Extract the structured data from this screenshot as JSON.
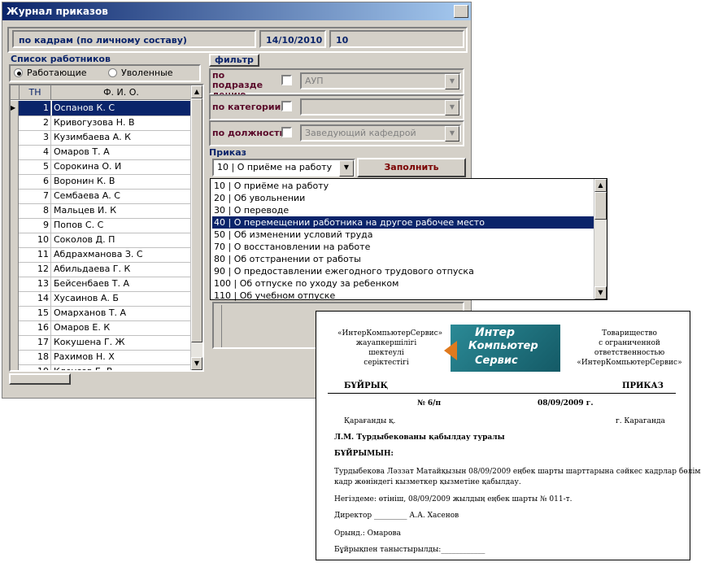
{
  "window": {
    "title": "Журнал приказов"
  },
  "header": {
    "department": "по кадрам (по личному составу)",
    "date": "14/10/2010",
    "number": "10"
  },
  "employees": {
    "title": "Список работников",
    "radio_working": "Работающие",
    "radio_fired": "Уволенные",
    "col_tn": "ТН",
    "col_fio": "Ф. И. О.",
    "rows": [
      {
        "tn": "1",
        "fio": "Оспанов К. С"
      },
      {
        "tn": "2",
        "fio": "Кривогузова Н. В"
      },
      {
        "tn": "3",
        "fio": "Кузимбаева А. К"
      },
      {
        "tn": "4",
        "fio": "Омаров Т. А"
      },
      {
        "tn": "5",
        "fio": "Сорокина О. И"
      },
      {
        "tn": "6",
        "fio": "Воронин К. В"
      },
      {
        "tn": "7",
        "fio": "Сембаева А. С"
      },
      {
        "tn": "8",
        "fio": "Мальцев И. К"
      },
      {
        "tn": "9",
        "fio": "Попов С. С"
      },
      {
        "tn": "10",
        "fio": "Соколов Д. П"
      },
      {
        "tn": "11",
        "fio": "Абдрахманова З. С"
      },
      {
        "tn": "12",
        "fio": "Абильдаева Г. К"
      },
      {
        "tn": "13",
        "fio": "Бейсенбаев Т. А"
      },
      {
        "tn": "14",
        "fio": "Хусаинов А. Б"
      },
      {
        "tn": "15",
        "fio": "Омарханов Т. А"
      },
      {
        "tn": "16",
        "fio": "Омаров Е. К"
      },
      {
        "tn": "17",
        "fio": "Кокушена Г. Ж"
      },
      {
        "tn": "18",
        "fio": "Рахимов Н. Х"
      },
      {
        "tn": "19",
        "fio": "Клеусов Е. В"
      }
    ]
  },
  "filter": {
    "tab": "фильтр",
    "dept_label": "по подразде лению",
    "dept_value": "АУП",
    "cat_label": "по категории",
    "cat_value": "",
    "pos_label": "по должности",
    "pos_value": "Заведующий кафедрой"
  },
  "order": {
    "title": "Приказ",
    "selected": "10 | О приёме на работу",
    "fill_button": "Заполнить",
    "options": [
      "10 | О приёме на работу",
      "20 | Об увольнении",
      "30 | О переводе",
      "40 | О перемещении работника на другое рабочее место",
      "50 | Об изменении условий труда",
      "70 | О восстановлении на работе",
      "80 | Об отстранении от работы",
      "90 | О предоставлении ежегодного трудового отпуска",
      "100 | Об отпуске по уходу за ребенком",
      "110 | Об учебном отпуске"
    ]
  },
  "document": {
    "left_org_1": "«ИнтерКомпьютерСервис»",
    "left_org_2": "жауапкершілігі",
    "left_org_3": "шектеулі",
    "left_org_4": "серіктестігі",
    "logo_1": "Интер",
    "logo_2": "Компьютер",
    "logo_3": "Сервис",
    "right_org_1": "Товарищество",
    "right_org_2": "с ограниченной",
    "right_org_3": "ответственностью",
    "right_org_4": "«ИнтерКомпьютерСервис»",
    "kz_title": "БҰЙРЫҚ",
    "ru_title": "ПРИКАЗ",
    "number": "№ 6/п",
    "date": "08/09/2009 г.",
    "city_kz": "Қарағанды қ.",
    "city_ru": "г. Караганда",
    "subject": "Л.М. Турдыбекованы қабылдау туралы",
    "order_word": "БҰЙРЫМЫН:",
    "body_1": "Турдыбекова Ләззат Матайқызын 08/09/2009 еңбек шарты шарттарына сәйкес кадрлар бөлімінің",
    "body_2": "кадр жөніндегі кызметкер қызметіне қабылдау.",
    "basis": "Негіздеме: өтініш, 08/09/2009 жылдың еңбек шарты № 011-т.",
    "director": "Директор _________ А.А. Хасенов",
    "executor": "Орынд.: Омарова",
    "acquainted": "Бұйрықпен таныстырылды:____________"
  },
  "colors": {
    "selection": "#0a246a",
    "window_bg": "#d4d0c8",
    "label_maroon": "#5a0a2a",
    "fill_button_text": "#7a0000",
    "logo_bg": "#1e6b78"
  }
}
